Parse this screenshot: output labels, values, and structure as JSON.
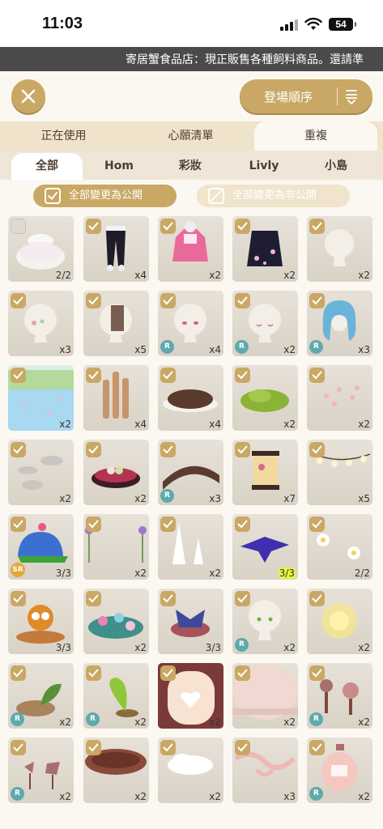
{
  "status": {
    "time": "11:03",
    "battery": "54"
  },
  "ticker": "寄居蟹食品店：現正販售各種飼料商品。還請準",
  "top": {
    "sort_label": "登場順序"
  },
  "tabs": [
    "正在使用",
    "心願清單",
    "重複"
  ],
  "active_tab": 2,
  "subtabs": [
    "全部",
    "Hom",
    "彩妝",
    "Livly",
    "小島"
  ],
  "active_subtab": 0,
  "public_all": "全部變更為公開",
  "private_all": "全部變更為非公開",
  "colors": {
    "accent": "#c9a865",
    "rarity_r": "#5fa9ac",
    "rarity_sr": "#e3a835"
  },
  "items": [
    {
      "name": "translucent-bowl",
      "count": "2/2",
      "checked": false,
      "rarity": ""
    },
    {
      "name": "black-pants",
      "count": "x4",
      "checked": true,
      "rarity": ""
    },
    {
      "name": "pink-hoodie",
      "count": "x2",
      "checked": true,
      "rarity": ""
    },
    {
      "name": "black-floral-kimono",
      "count": "x2",
      "checked": true,
      "rarity": ""
    },
    {
      "name": "head-side-view",
      "count": "x2",
      "checked": true,
      "rarity": ""
    },
    {
      "name": "head-with-flower",
      "count": "x3",
      "checked": true,
      "rarity": ""
    },
    {
      "name": "head-with-tag",
      "count": "x5",
      "checked": true,
      "rarity": ""
    },
    {
      "name": "head-pink-eyes",
      "count": "x4",
      "checked": true,
      "rarity": "R"
    },
    {
      "name": "head-closed-eyes",
      "count": "x2",
      "checked": true,
      "rarity": "R"
    },
    {
      "name": "blue-wavy-hair",
      "count": "x3",
      "checked": true,
      "rarity": "R"
    },
    {
      "name": "sakura-pond",
      "count": "x2",
      "checked": true,
      "rarity": ""
    },
    {
      "name": "bamboo-lanterns",
      "count": "x4",
      "checked": true,
      "rarity": ""
    },
    {
      "name": "soil-mound",
      "count": "x4",
      "checked": true,
      "rarity": ""
    },
    {
      "name": "green-moss",
      "count": "x2",
      "checked": true,
      "rarity": ""
    },
    {
      "name": "petal-scatter",
      "count": "x2",
      "checked": true,
      "rarity": ""
    },
    {
      "name": "stepping-stones",
      "count": "x2",
      "checked": true,
      "rarity": ""
    },
    {
      "name": "dango-tray",
      "count": "x2",
      "checked": true,
      "rarity": ""
    },
    {
      "name": "arched-bridge",
      "count": "x3",
      "checked": true,
      "rarity": "R"
    },
    {
      "name": "floor-lantern",
      "count": "x7",
      "checked": true,
      "rarity": ""
    },
    {
      "name": "lantern-string",
      "count": "x5",
      "checked": true,
      "rarity": ""
    },
    {
      "name": "livly-cap",
      "count": "3/3",
      "checked": true,
      "rarity": "SR"
    },
    {
      "name": "purple-flower-stems",
      "count": "x2",
      "checked": true,
      "rarity": ""
    },
    {
      "name": "white-spikes",
      "count": "x2",
      "checked": true,
      "rarity": ""
    },
    {
      "name": "paper-crane",
      "count": "3/3",
      "checked": true,
      "rarity": "",
      "highlight": true
    },
    {
      "name": "white-flowers",
      "count": "2/2",
      "checked": true,
      "rarity": ""
    },
    {
      "name": "owl-figure",
      "count": "3/3",
      "checked": true,
      "rarity": ""
    },
    {
      "name": "flower-bed",
      "count": "x2",
      "checked": true,
      "rarity": ""
    },
    {
      "name": "ribbon-collar",
      "count": "3/3",
      "checked": true,
      "rarity": ""
    },
    {
      "name": "head-green-eyes",
      "count": "x2",
      "checked": true,
      "rarity": "R"
    },
    {
      "name": "glow-light",
      "count": "x2",
      "checked": true,
      "rarity": ""
    },
    {
      "name": "leaf-sprout",
      "count": "x2",
      "checked": true,
      "rarity": "R"
    },
    {
      "name": "seedling",
      "count": "x2",
      "checked": true,
      "rarity": "R"
    },
    {
      "name": "heart-mirror-frame",
      "count": "x2",
      "checked": true,
      "rarity": ""
    },
    {
      "name": "round-table",
      "count": "x2",
      "checked": true,
      "rarity": ""
    },
    {
      "name": "bear-stand-pair",
      "count": "x2",
      "checked": true,
      "rarity": "R"
    },
    {
      "name": "animal-silhouettes",
      "count": "x2",
      "checked": true,
      "rarity": "R"
    },
    {
      "name": "round-rug",
      "count": "x2",
      "checked": true,
      "rarity": ""
    },
    {
      "name": "cloud-cushion",
      "count": "x2",
      "checked": true,
      "rarity": ""
    },
    {
      "name": "pink-ribbon",
      "count": "x3",
      "checked": true,
      "rarity": ""
    },
    {
      "name": "perfume-bottle",
      "count": "x2",
      "checked": true,
      "rarity": "R"
    }
  ]
}
